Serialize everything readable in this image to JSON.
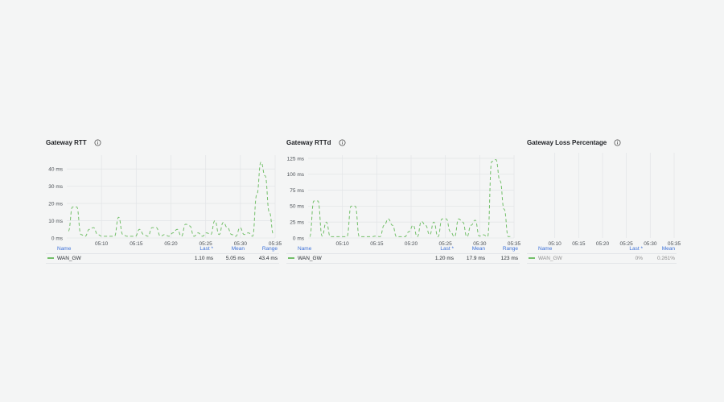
{
  "series_color": "#73bf69",
  "panels": [
    {
      "title": "Gateway RTT",
      "legend": {
        "headers": [
          "Name",
          "Last *",
          "Mean",
          "Range"
        ],
        "row": [
          "WAN_GW",
          "1.10 ms",
          "5.05 ms",
          "43.4 ms"
        ]
      }
    },
    {
      "title": "Gateway RTTd",
      "legend": {
        "headers": [
          "Name",
          "Last *",
          "Mean",
          "Range"
        ],
        "row": [
          "WAN_GW",
          "1.20 ms",
          "17.9 ms",
          "123 ms"
        ]
      }
    },
    {
      "title": "Gateway Loss Percentage",
      "legend": {
        "headers": [
          "Name",
          "Last *",
          "Mean"
        ],
        "row": [
          "WAN_GW",
          "0%",
          "0.261%"
        ]
      }
    }
  ],
  "chart_data": [
    {
      "type": "line",
      "series": [
        {
          "name": "WAN_GW",
          "values": [
            4,
            18,
            18,
            2,
            1,
            5,
            6,
            2,
            1,
            1,
            1,
            1,
            12,
            2,
            1,
            1,
            1,
            5,
            2,
            1,
            6,
            6,
            1,
            2,
            1,
            3,
            5,
            1,
            8,
            7,
            1,
            3,
            1,
            3,
            2,
            10,
            2,
            9,
            6,
            2,
            1,
            6,
            2,
            3,
            1,
            25,
            44,
            36,
            15,
            2
          ]
        }
      ],
      "xticks": [
        "05:10",
        "05:15",
        "05:20",
        "05:25",
        "05:30",
        "05:35"
      ],
      "yticks": [
        "0 ms",
        "10 ms",
        "20 ms",
        "30 ms",
        "40 ms"
      ],
      "ylim": [
        0,
        48
      ]
    },
    {
      "type": "line",
      "series": [
        {
          "name": "WAN_GW",
          "values": [
            2,
            58,
            58,
            3,
            25,
            2,
            2,
            2,
            2,
            2,
            50,
            50,
            2,
            2,
            2,
            2,
            3,
            2,
            20,
            30,
            20,
            2,
            2,
            2,
            10,
            20,
            2,
            26,
            20,
            5,
            25,
            2,
            30,
            30,
            10,
            2,
            30,
            25,
            2,
            20,
            28,
            3,
            5,
            2,
            120,
            123,
            90,
            45,
            2,
            3
          ]
        }
      ],
      "xticks": [
        "05:10",
        "05:15",
        "05:20",
        "05:25",
        "05:30",
        "05:35"
      ],
      "yticks": [
        "0 ms",
        "25 ms",
        "50 ms",
        "75 ms",
        "100 ms",
        "125 ms"
      ],
      "ylim": [
        0,
        130
      ]
    },
    {
      "type": "line",
      "series": [
        {
          "name": "WAN_GW",
          "values": []
        }
      ],
      "xticks": [
        "05:10",
        "05:15",
        "05:20",
        "05:25",
        "05:30",
        "05:35"
      ],
      "yticks": [],
      "ylim": [
        0,
        1
      ]
    }
  ]
}
